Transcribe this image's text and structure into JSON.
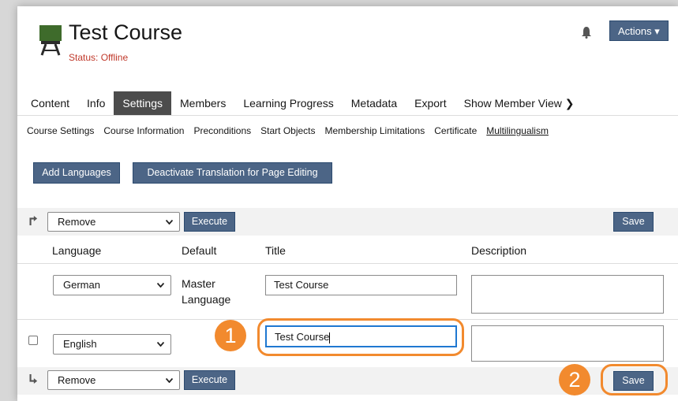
{
  "course": {
    "title": "Test Course",
    "status": "Status: Offline"
  },
  "header": {
    "actions_label": "Actions ▾"
  },
  "tabs": [
    {
      "label": "Content"
    },
    {
      "label": "Info"
    },
    {
      "label": "Settings"
    },
    {
      "label": "Members"
    },
    {
      "label": "Learning Progress"
    },
    {
      "label": "Metadata"
    },
    {
      "label": "Export"
    },
    {
      "label": "Show Member View ❯"
    }
  ],
  "subtabs": [
    {
      "label": "Course Settings"
    },
    {
      "label": "Course Information"
    },
    {
      "label": "Preconditions"
    },
    {
      "label": "Start Objects"
    },
    {
      "label": "Membership Limitations"
    },
    {
      "label": "Certificate"
    },
    {
      "label": "Multilingualism"
    }
  ],
  "buttons": {
    "add_languages": "Add Languages",
    "deactivate_translation": "Deactivate Translation for Page Editing",
    "execute": "Execute",
    "save": "Save"
  },
  "bulk": {
    "selected": "Remove"
  },
  "table": {
    "headers": {
      "language": "Language",
      "default": "Default",
      "title": "Title",
      "description": "Description"
    },
    "rows": [
      {
        "language": "German",
        "default_line1": "Master",
        "default_line2": "Language",
        "title": "Test Course",
        "description": ""
      },
      {
        "language": "English",
        "default_line1": "",
        "default_line2": "",
        "title": "Test Course",
        "description": ""
      }
    ]
  },
  "callouts": {
    "one": "1",
    "two": "2"
  },
  "colors": {
    "primary_button": "#4c6586",
    "callout": "#f28a2e",
    "status": "#c0392b",
    "active_tab": "#4c4c4c"
  }
}
